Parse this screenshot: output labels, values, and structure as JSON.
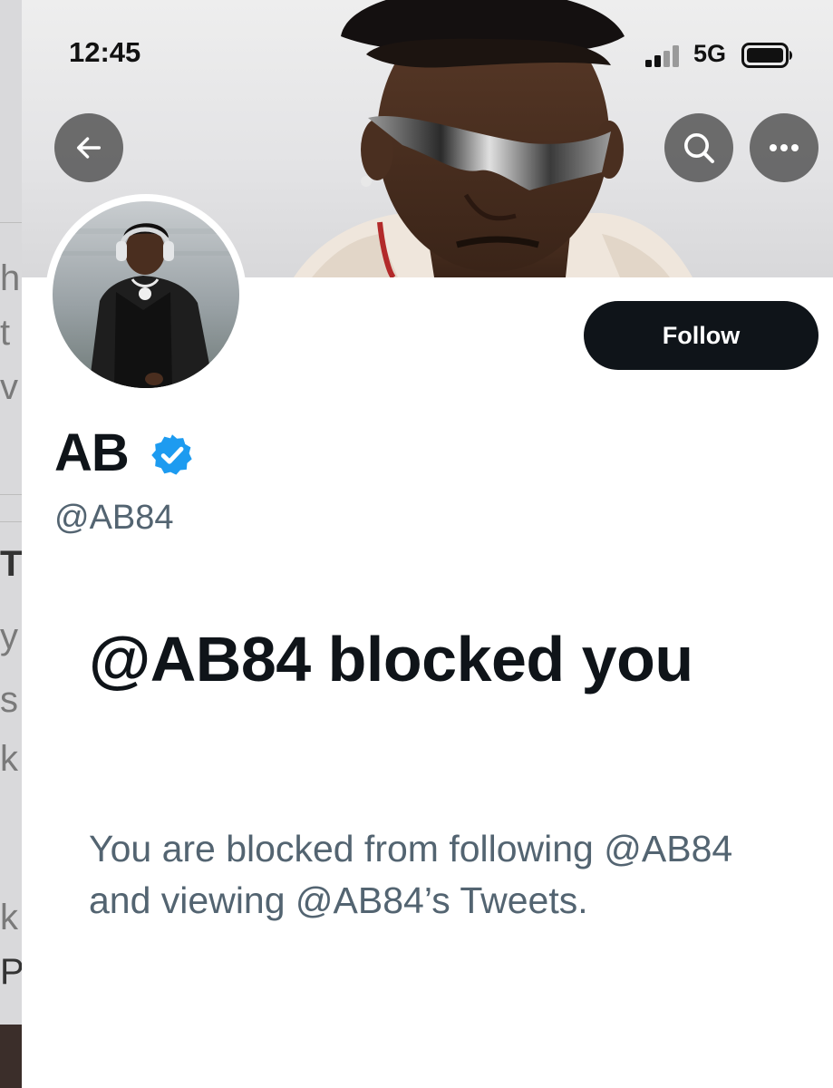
{
  "status_bar": {
    "time": "12:45",
    "network": "5G"
  },
  "header": {
    "back_icon": "arrow-left-icon",
    "search_icon": "search-icon",
    "more_icon": "more-horizontal-icon"
  },
  "profile": {
    "display_name": "AB",
    "handle": "@AB84",
    "verified": true,
    "verified_color": "#1d9bf0",
    "follow_label": "Follow"
  },
  "blocked": {
    "title": "@AB84 blocked you",
    "description": "You are blocked from following @AB84 and viewing @AB84’s Tweets."
  },
  "background_fragments": [
    "ha",
    "t",
    "v",
    "Tr",
    "y",
    "s",
    "k",
    "k",
    "P"
  ],
  "colors": {
    "primary_text": "#0f1419",
    "secondary_text": "#536471",
    "follow_button": "#0f1419"
  }
}
